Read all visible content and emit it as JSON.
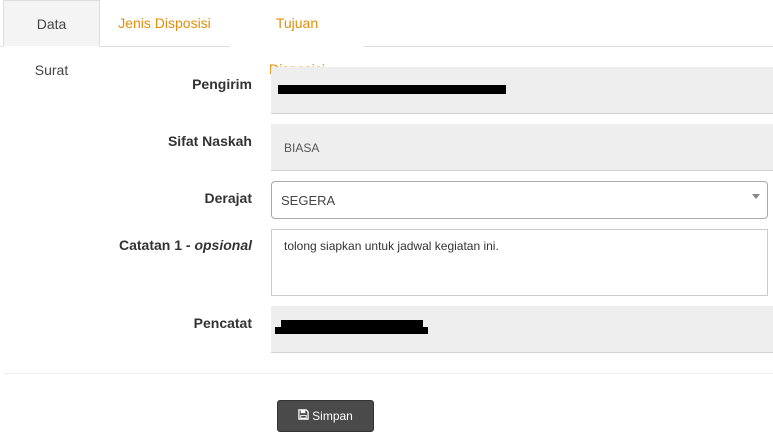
{
  "tabs": [
    {
      "label": "Data Surat",
      "active": true
    },
    {
      "label": "Jenis Disposisi",
      "active": false
    },
    {
      "label": "Tujuan Disposisi",
      "active": false
    }
  ],
  "form": {
    "pengirim": {
      "label": "Pengirim",
      "value_redacted": true
    },
    "sifat_naskah": {
      "label": "Sifat Naskah",
      "value": "BIASA"
    },
    "derajat": {
      "label": "Derajat",
      "selected": "SEGERA"
    },
    "catatan": {
      "label_main": "Catatan 1 - ",
      "label_optional": "opsional",
      "value": "tolong siapkan untuk jadwal kegiatan ini."
    },
    "pencatat": {
      "label": "Pencatat",
      "value_redacted": true
    }
  },
  "actions": {
    "save_label": "Simpan",
    "save_icon": "save-icon"
  },
  "colors": {
    "tab_inactive": "#e08e0b",
    "field_bg": "#eeeeee",
    "button_bg": "#4a4a4a"
  }
}
